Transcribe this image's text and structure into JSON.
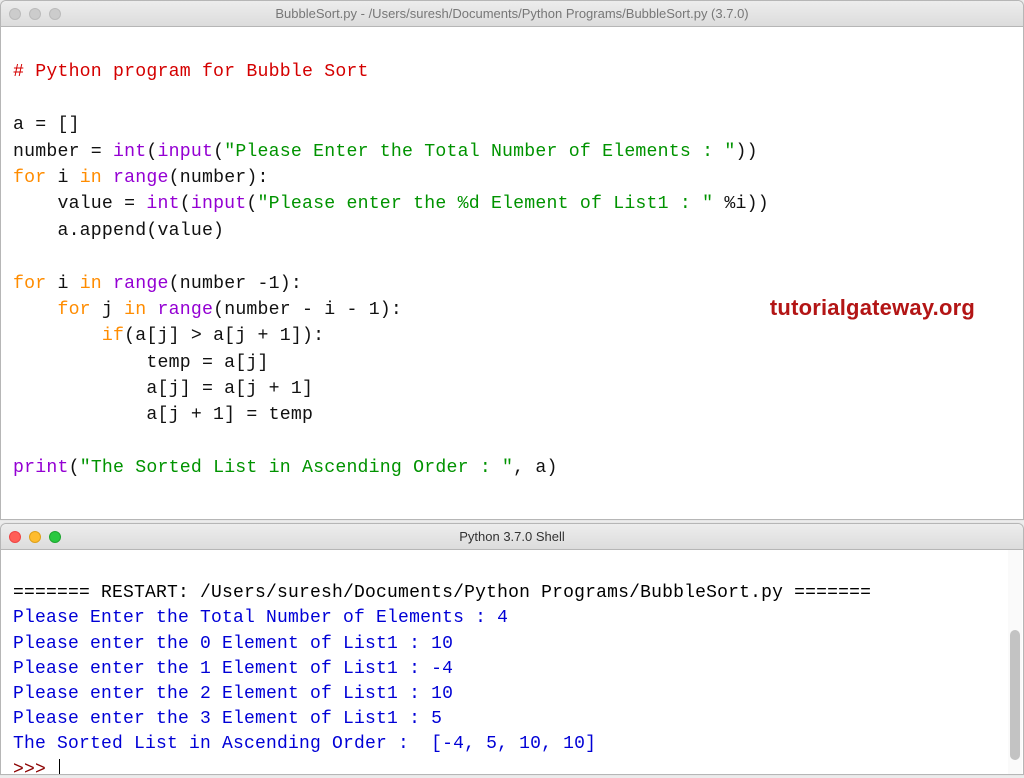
{
  "editor": {
    "title": "BubbleSort.py - /Users/suresh/Documents/Python Programs/BubbleSort.py (3.7.0)",
    "code": {
      "l1_comment": "# Python program for Bubble Sort",
      "l3_a": "a = []",
      "l4_number_lhs": "number = ",
      "l4_int": "int",
      "l4_input": "input",
      "l4_str": "\"Please Enter the Total Number of Elements : \"",
      "l5_for": "for",
      "l5_i": " i ",
      "l5_in": "in",
      "l5_space": " ",
      "l5_range": "range",
      "l5_args": "(number):",
      "l6_lhs": "    value = ",
      "l6_int": "int",
      "l6_input": "input",
      "l6_str": "\"Please enter the %d Element of List1 : \"",
      "l6_tail": " %i))",
      "l7": "    a.append(value)",
      "l9_for": "for",
      "l9_i": " i ",
      "l9_in": "in",
      "l9_space": " ",
      "l9_range": "range",
      "l9_args": "(number -1):",
      "l10_for": "    for",
      "l10_j": " j ",
      "l10_in": "in",
      "l10_space": " ",
      "l10_range": "range",
      "l10_args": "(number - i - 1):",
      "l11_if": "        if",
      "l11_cond": "(a[j] > a[j + 1]):",
      "l12": "            temp = a[j]",
      "l13": "            a[j] = a[j + 1]",
      "l14": "            a[j + 1] = temp",
      "l16_print": "print",
      "l16_open": "(",
      "l16_str": "\"The Sorted List in Ascending Order : \"",
      "l16_tail": ", a)"
    },
    "watermark": "tutorialgateway.org"
  },
  "shell": {
    "title": "Python 3.7.0 Shell",
    "lines": {
      "restart": "======= RESTART: /Users/suresh/Documents/Python Programs/BubbleSort.py =======",
      "p0": "Please Enter the Total Number of Elements : 4",
      "p1": "Please enter the 0 Element of List1 : 10",
      "p2": "Please enter the 1 Element of List1 : -4",
      "p3": "Please enter the 2 Element of List1 : 10",
      "p4": "Please enter the 3 Element of List1 : 5",
      "result": "The Sorted List in Ascending Order :  [-4, 5, 10, 10]",
      "prompt": ">>> "
    }
  }
}
